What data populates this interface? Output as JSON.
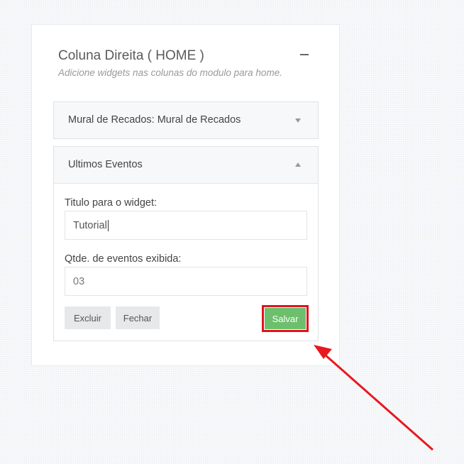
{
  "panel": {
    "title": "Coluna Direita ( HOME )",
    "subtitle": "Adicione widgets nas colunas do modulo para home."
  },
  "widgets": [
    {
      "title": "Mural de Recados: Mural de Recados",
      "state": "collapsed"
    },
    {
      "title": "Ultimos Eventos",
      "state": "expanded",
      "fields": {
        "title_label": "Titulo para o widget:",
        "title_value": "Tutorial",
        "count_label": "Qtde. de eventos exibida:",
        "count_value": "03"
      },
      "buttons": {
        "delete": "Excluir",
        "close": "Fechar",
        "save": "Salvar"
      }
    }
  ],
  "colors": {
    "save_button": "#6cbf6c",
    "highlight": "#e0131c"
  },
  "icons": {
    "collapse": "minus-icon",
    "collapsed_caret": "caret-down-icon",
    "expanded_caret": "caret-up-icon",
    "annotation": "red-arrow"
  }
}
